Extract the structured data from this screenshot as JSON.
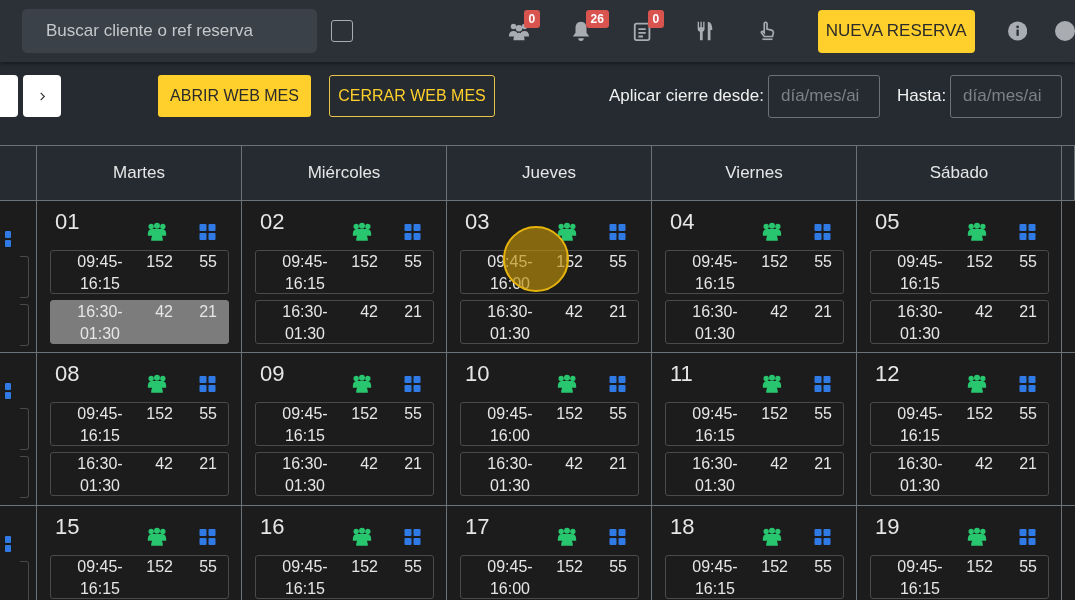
{
  "search": {
    "placeholder": "Buscar cliente o ref reserva"
  },
  "filter_checkbox": {
    "checked": false
  },
  "header_icons": [
    {
      "kind": "people",
      "badge": "0"
    },
    {
      "kind": "bell",
      "badge": "26"
    },
    {
      "kind": "list",
      "badge": "0"
    },
    {
      "kind": "dining"
    },
    {
      "kind": "pointer"
    }
  ],
  "new_button": "NUEVA RESERVA",
  "toolbar": {
    "open_button": "ABRIR WEB MES",
    "close_button": "CERRAR WEB MES",
    "from_label": "Aplicar cierre desde:",
    "from_placeholder": "día/mes/ai",
    "to_label": "Hasta:",
    "to_placeholder": "día/mes/ai"
  },
  "calendar": {
    "days": [
      "Martes",
      "Miércoles",
      "Jueves",
      "Viernes",
      "Sábado"
    ],
    "weeks": [
      {
        "cells": [
          {
            "date": "01",
            "slots": [
              {
                "time": "09:45-16:15",
                "guests": "152",
                "tables": "55",
                "highlighted": false
              },
              {
                "time": "16:30-01:30",
                "guests": "42",
                "tables": "21",
                "highlighted": true
              }
            ]
          },
          {
            "date": "02",
            "slots": [
              {
                "time": "09:45-16:15",
                "guests": "152",
                "tables": "55",
                "highlighted": false
              },
              {
                "time": "16:30-01:30",
                "guests": "42",
                "tables": "21",
                "highlighted": false
              }
            ]
          },
          {
            "date": "03",
            "slots": [
              {
                "time": "09:45-16:00",
                "guests": "152",
                "tables": "55",
                "highlighted": false
              },
              {
                "time": "16:30-01:30",
                "guests": "42",
                "tables": "21",
                "highlighted": false
              }
            ]
          },
          {
            "date": "04",
            "slots": [
              {
                "time": "09:45-16:15",
                "guests": "152",
                "tables": "55",
                "highlighted": false
              },
              {
                "time": "16:30-01:30",
                "guests": "42",
                "tables": "21",
                "highlighted": false
              }
            ]
          },
          {
            "date": "05",
            "slots": [
              {
                "time": "09:45-16:15",
                "guests": "152",
                "tables": "55",
                "highlighted": false
              },
              {
                "time": "16:30-01:30",
                "guests": "42",
                "tables": "21",
                "highlighted": false
              }
            ]
          }
        ]
      },
      {
        "cells": [
          {
            "date": "08",
            "slots": [
              {
                "time": "09:45-16:15",
                "guests": "152",
                "tables": "55",
                "highlighted": false
              },
              {
                "time": "16:30-01:30",
                "guests": "42",
                "tables": "21",
                "highlighted": false
              }
            ]
          },
          {
            "date": "09",
            "slots": [
              {
                "time": "09:45-16:15",
                "guests": "152",
                "tables": "55",
                "highlighted": false
              },
              {
                "time": "16:30-01:30",
                "guests": "42",
                "tables": "21",
                "highlighted": false
              }
            ]
          },
          {
            "date": "10",
            "slots": [
              {
                "time": "09:45-16:00",
                "guests": "152",
                "tables": "55",
                "highlighted": false
              },
              {
                "time": "16:30-01:30",
                "guests": "42",
                "tables": "21",
                "highlighted": false
              }
            ]
          },
          {
            "date": "11",
            "slots": [
              {
                "time": "09:45-16:15",
                "guests": "152",
                "tables": "55",
                "highlighted": false
              },
              {
                "time": "16:30-01:30",
                "guests": "42",
                "tables": "21",
                "highlighted": false
              }
            ]
          },
          {
            "date": "12",
            "slots": [
              {
                "time": "09:45-16:15",
                "guests": "152",
                "tables": "55",
                "highlighted": false
              },
              {
                "time": "16:30-01:30",
                "guests": "42",
                "tables": "21",
                "highlighted": false
              }
            ]
          }
        ]
      },
      {
        "cells": [
          {
            "date": "15",
            "slots": [
              {
                "time": "09:45-16:15",
                "guests": "152",
                "tables": "55",
                "highlighted": false
              }
            ]
          },
          {
            "date": "16",
            "slots": [
              {
                "time": "09:45-16:15",
                "guests": "152",
                "tables": "55",
                "highlighted": false
              }
            ]
          },
          {
            "date": "17",
            "slots": [
              {
                "time": "09:45-16:00",
                "guests": "152",
                "tables": "55",
                "highlighted": false
              }
            ]
          },
          {
            "date": "18",
            "slots": [
              {
                "time": "09:45-16:15",
                "guests": "152",
                "tables": "55",
                "highlighted": false
              }
            ]
          },
          {
            "date": "19",
            "slots": [
              {
                "time": "09:45-16:15",
                "guests": "152",
                "tables": "55",
                "highlighted": false
              }
            ]
          }
        ]
      }
    ]
  }
}
